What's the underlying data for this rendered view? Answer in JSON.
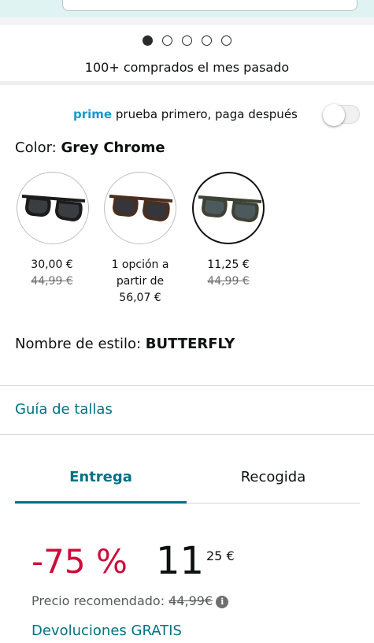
{
  "carousel": {
    "total": 5,
    "active_index": 0
  },
  "social_proof": "100+ comprados el mes pasado",
  "prime": {
    "brand": "prime",
    "text": "prueba primero, paga después",
    "toggle_on": false
  },
  "color": {
    "label": "Color:",
    "selected": "Grey Chrome",
    "options": [
      {
        "frame_color": "#1c1c1c",
        "lens_color": "#3a3d42",
        "price": "30,00 €",
        "strike": "44,99 €",
        "selected": false
      },
      {
        "frame_color": "#4a2e1e",
        "lens_color": "#34363b",
        "text_lines": [
          "1 opción a",
          "partir de",
          "56,07 €"
        ],
        "selected": false
      },
      {
        "frame_color": "#3e4235",
        "lens_color": "#4c5a5e",
        "price": "11,25 €",
        "strike": "44,99 €",
        "selected": true
      }
    ]
  },
  "style": {
    "label": "Nombre de estilo:",
    "value": "BUTTERFLY"
  },
  "size_guide": "Guía de tallas",
  "tabs": {
    "delivery": "Entrega",
    "pickup": "Recogida",
    "active": "delivery"
  },
  "pricing": {
    "discount": "-75 %",
    "price_whole": "11",
    "price_fraction": "25 €",
    "recommended_label": "Precio recomendado:",
    "recommended_value": "44,99€"
  },
  "returns": "Devoluciones GRATIS"
}
